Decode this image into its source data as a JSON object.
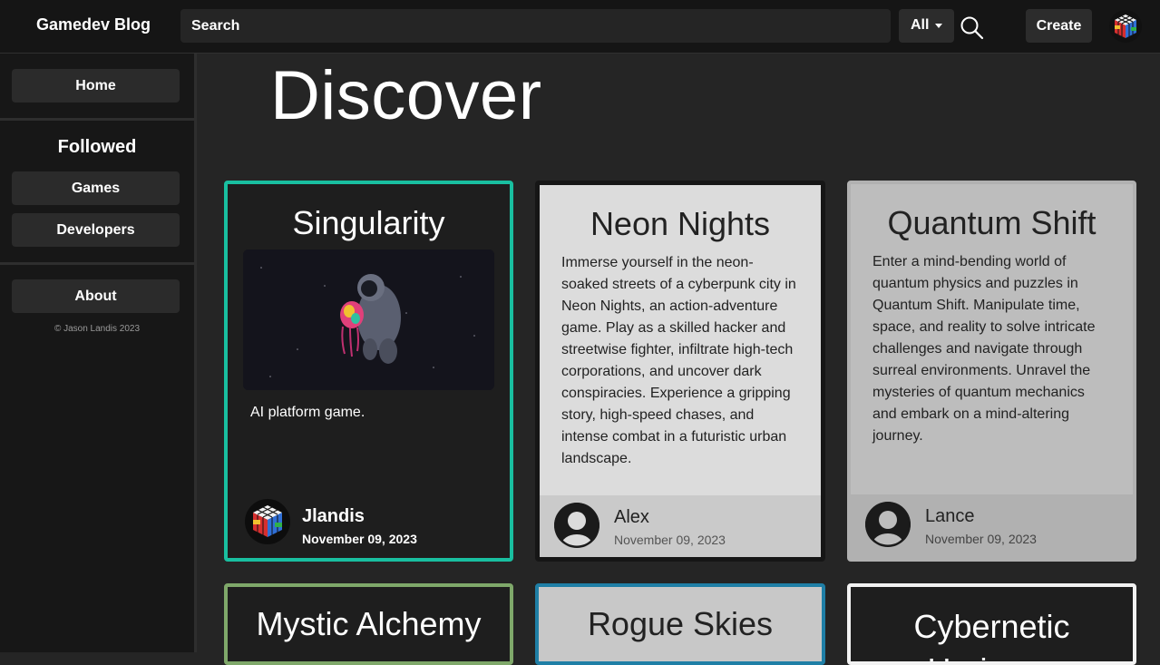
{
  "header": {
    "brand": "Gamedev Blog",
    "search_placeholder": "Search",
    "filter_selected": "All",
    "create_label": "Create"
  },
  "sidebar": {
    "home": "Home",
    "followed_heading": "Followed",
    "games": "Games",
    "developers": "Developers",
    "about": "About",
    "copyright": "© Jason Landis 2023"
  },
  "main": {
    "title": "Discover",
    "cards": [
      {
        "title": "Singularity",
        "description": "AI platform game.",
        "author": "Jlandis",
        "date": "November 09, 2023",
        "accent": "#19bfa0"
      },
      {
        "title": "Neon Nights",
        "description": "Immerse yourself in the neon-soaked streets of a cyberpunk city in Neon Nights, an action-adventure game. Play as a skilled hacker and streetwise fighter, infiltrate high-tech corporations, and uncover dark conspiracies. Experience a gripping story, high-speed chases, and intense combat in a futuristic urban landscape.",
        "author": "Alex",
        "date": "November 09, 2023"
      },
      {
        "title": "Quantum Shift",
        "description": "Enter a mind-bending world of quantum physics and puzzles in Quantum Shift. Manipulate time, space, and reality to solve intricate challenges and navigate through surreal environments. Unravel the mysteries of quantum mechanics and embark on a mind-altering journey.",
        "author": "Lance",
        "date": "November 09, 2023"
      },
      {
        "title": "Mystic Alchemy",
        "accent": "#7fa86a"
      },
      {
        "title": "Rogue Skies",
        "accent": "#1f7fa6"
      },
      {
        "title": "Cybernetic Horizons",
        "accent": "#f2f2f2"
      }
    ]
  },
  "icons": {
    "search": "search-icon",
    "caret": "caret-down-icon",
    "profile": "rubiks-cube-avatar",
    "default_avatar": "default-user-avatar"
  }
}
